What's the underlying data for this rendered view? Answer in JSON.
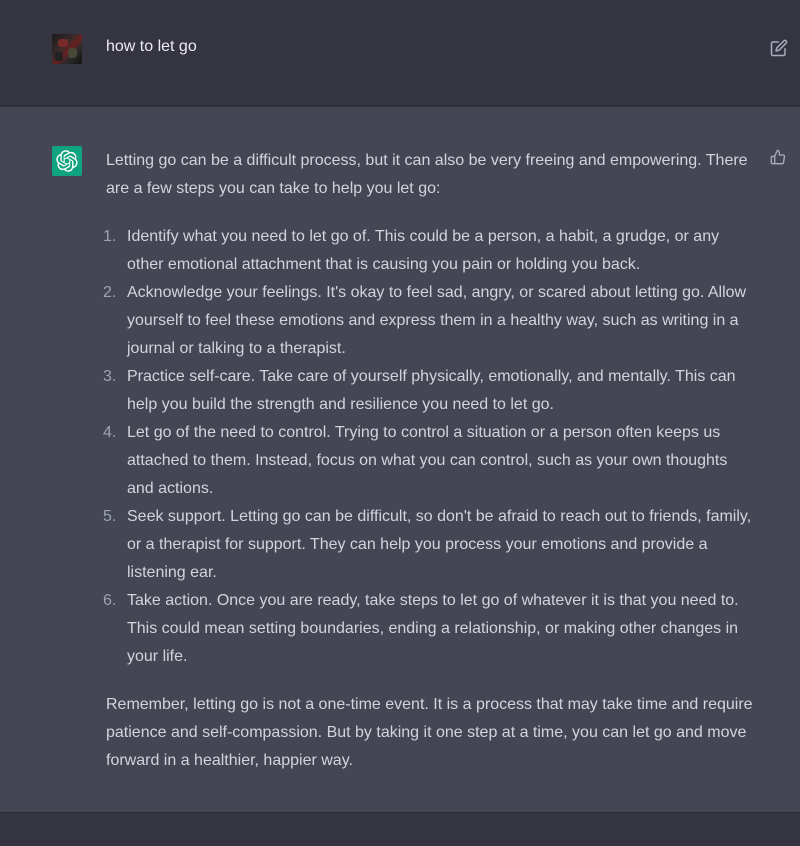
{
  "user_message": {
    "text": "how to let go",
    "avatar": "user-avatar-photo"
  },
  "assistant_message": {
    "intro": "Letting go can be a difficult process, but it can also be very freeing and empowering. There are a few steps you can take to help you let go:",
    "steps": [
      {
        "num": "1.",
        "text": "Identify what you need to let go of. This could be a person, a habit, a grudge, or any other emotional attachment that is causing you pain or holding you back."
      },
      {
        "num": "2.",
        "text": "Acknowledge your feelings. It's okay to feel sad, angry, or scared about letting go. Allow yourself to feel these emotions and express them in a healthy way, such as writing in a journal or talking to a therapist."
      },
      {
        "num": "3.",
        "text": "Practice self-care. Take care of yourself physically, emotionally, and mentally. This can help you build the strength and resilience you need to let go."
      },
      {
        "num": "4.",
        "text": "Let go of the need to control. Trying to control a situation or a person often keeps us attached to them. Instead, focus on what you can control, such as your own thoughts and actions."
      },
      {
        "num": "5.",
        "text": "Seek support. Letting go can be difficult, so don't be afraid to reach out to friends, family, or a therapist for support. They can help you process your emotions and provide a listening ear."
      },
      {
        "num": "6.",
        "text": "Take action. Once you are ready, take steps to let go of whatever it is that you need to. This could mean setting boundaries, ending a relationship, or making other changes in your life."
      }
    ],
    "outro": "Remember, letting go is not a one-time event. It is a process that may take time and require patience and self-compassion. But by taking it one step at a time, you can let go and move forward in a healthier, happier way."
  },
  "icons": {
    "edit": "edit-icon",
    "thumbs_up": "thumbs-up-icon",
    "assistant_logo": "openai-logo-icon"
  },
  "colors": {
    "background": "#343541",
    "assistant_background": "#444654",
    "accent": "#10a37f",
    "text": "#d1d5db"
  }
}
